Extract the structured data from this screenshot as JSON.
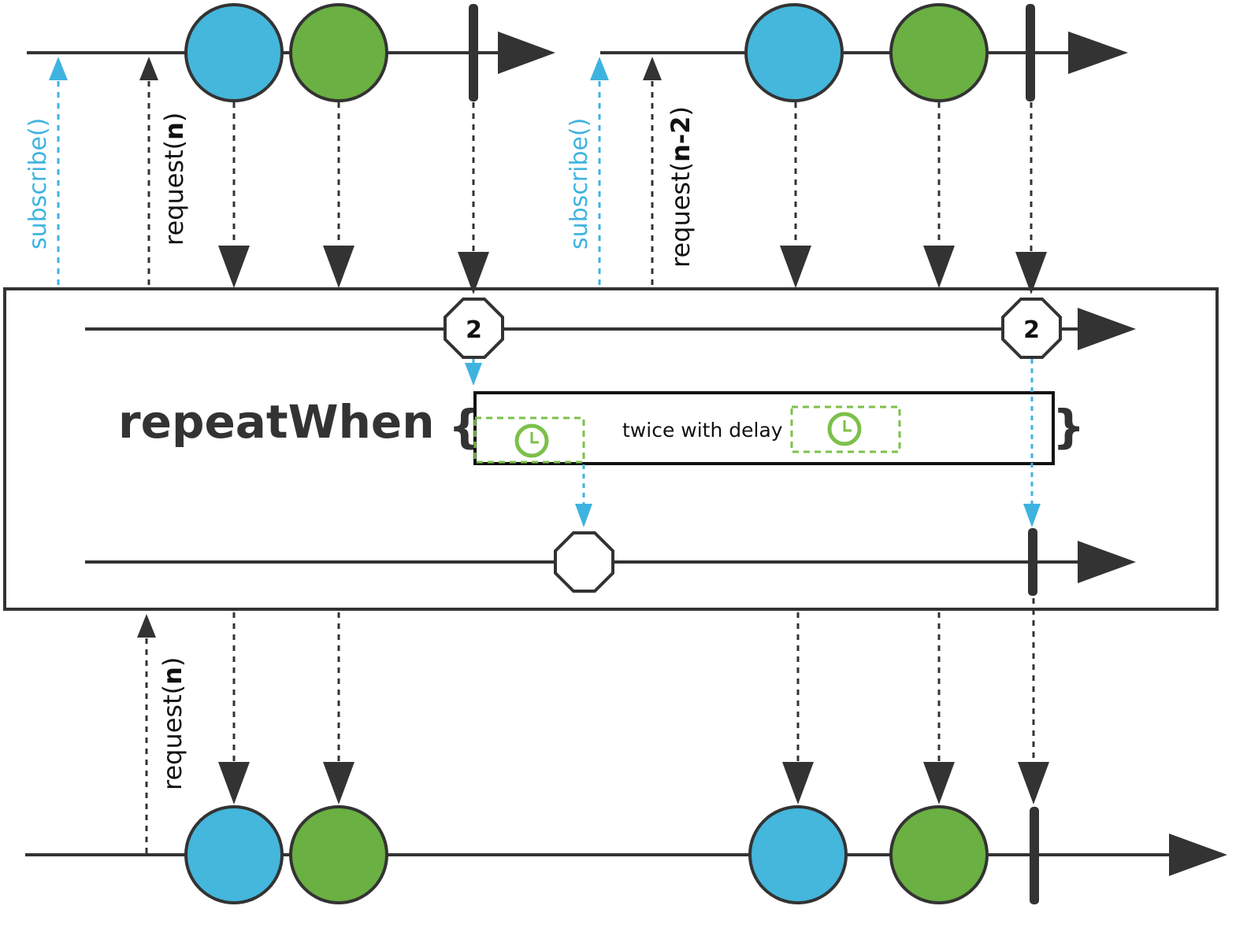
{
  "colors": {
    "line": "#333333",
    "blue": "#45b6dc",
    "green": "#6ab042",
    "clock": "#7cc04a",
    "cyan": "#3fb3e0",
    "white": "#ffffff"
  },
  "source_1": {
    "subscribe_label": "subscribe()",
    "request_prefix": "request(",
    "request_arg": "n",
    "request_suffix": ")",
    "items": [
      {
        "kind": "item",
        "color": "blue"
      },
      {
        "kind": "item",
        "color": "green"
      },
      {
        "kind": "complete"
      }
    ]
  },
  "source_2": {
    "subscribe_label": "subscribe()",
    "request_prefix": "request(",
    "request_arg": "n-2",
    "request_suffix": ")",
    "items": [
      {
        "kind": "item",
        "color": "blue"
      },
      {
        "kind": "item",
        "color": "green"
      },
      {
        "kind": "complete"
      }
    ]
  },
  "operator": {
    "name": "repeatWhen",
    "open_brace": "{",
    "close_brace": "}",
    "signal_value_1": "2",
    "signal_value_2": "2",
    "companion_label": "twice with delay",
    "delay_icon": "clock-icon"
  },
  "output": {
    "request_prefix": "request(",
    "request_arg": "n",
    "request_suffix": ")",
    "items": [
      {
        "kind": "item",
        "color": "blue"
      },
      {
        "kind": "item",
        "color": "green"
      },
      {
        "kind": "item",
        "color": "blue"
      },
      {
        "kind": "item",
        "color": "green"
      },
      {
        "kind": "complete"
      }
    ]
  }
}
